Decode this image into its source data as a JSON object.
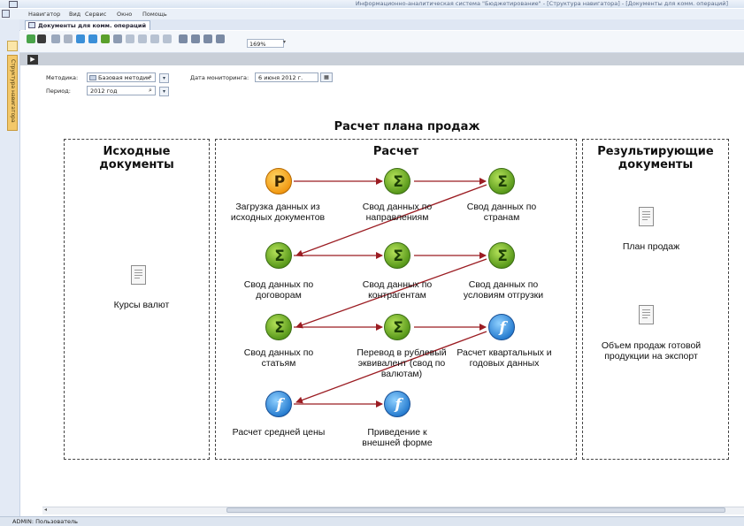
{
  "window": {
    "title": "Информационно-аналитическая система \"Бюджетирование\" - [Структура навигатора] - [Документы для комм. операций]"
  },
  "menu": [
    "Навигатор",
    "Вид",
    "Сервис",
    "Окно",
    "Помощь"
  ],
  "sidebar": {
    "label": "Структура навигатора"
  },
  "doc_tab": {
    "label": "Документы для комм. операций"
  },
  "toolbar": {
    "zoom": "169%"
  },
  "params": {
    "methodology_label": "Методика:",
    "methodology_value": "Базовая методик",
    "period_label": "Период:",
    "period_value": "2012 год",
    "monitoring_label": "Дата мониторинга:",
    "monitoring_value": "6  июня  2012 г."
  },
  "diagram": {
    "title": "Расчет плана продаж",
    "panels": {
      "source": "Исходные документы",
      "calc": "Расчет",
      "result": "Результирующие документы"
    },
    "source_docs": [
      "Курсы валют"
    ],
    "result_docs": [
      "План продаж",
      "Объем продаж готовой продукции на экспорт"
    ],
    "nodes": [
      {
        "id": "n1",
        "type": "report",
        "glyph": "P",
        "label": "Загрузка данных из исходных документов"
      },
      {
        "id": "n2",
        "type": "sigma",
        "glyph": "Σ",
        "label": "Свод данных по направлениям"
      },
      {
        "id": "n3",
        "type": "sigma",
        "glyph": "Σ",
        "label": "Свод данных по странам"
      },
      {
        "id": "n4",
        "type": "sigma",
        "glyph": "Σ",
        "label": "Свод данных по договорам"
      },
      {
        "id": "n5",
        "type": "sigma",
        "glyph": "Σ",
        "label": "Свод данных по контрагентам"
      },
      {
        "id": "n6",
        "type": "sigma",
        "glyph": "Σ",
        "label": "Свод данных по условиям отгрузки"
      },
      {
        "id": "n7",
        "type": "sigma",
        "glyph": "Σ",
        "label": "Свод данных по статьям"
      },
      {
        "id": "n8",
        "type": "sigma",
        "glyph": "Σ",
        "label": "Перевод в рублевый эквивалент (свод по валютам)"
      },
      {
        "id": "n9",
        "type": "func",
        "glyph": "f",
        "label": "Расчет квартальных и годовых данных"
      },
      {
        "id": "n10",
        "type": "func",
        "glyph": "f",
        "label": "Расчет средней цены"
      },
      {
        "id": "n11",
        "type": "func",
        "glyph": "f",
        "label": "Приведение к внешней форме"
      }
    ]
  },
  "status": {
    "user": "ADMIN: Пользователь"
  },
  "colors": {
    "arrow": "#9b1c22",
    "sigma": "#6aa82a",
    "report": "#f29a14",
    "func": "#2a7fd1"
  }
}
